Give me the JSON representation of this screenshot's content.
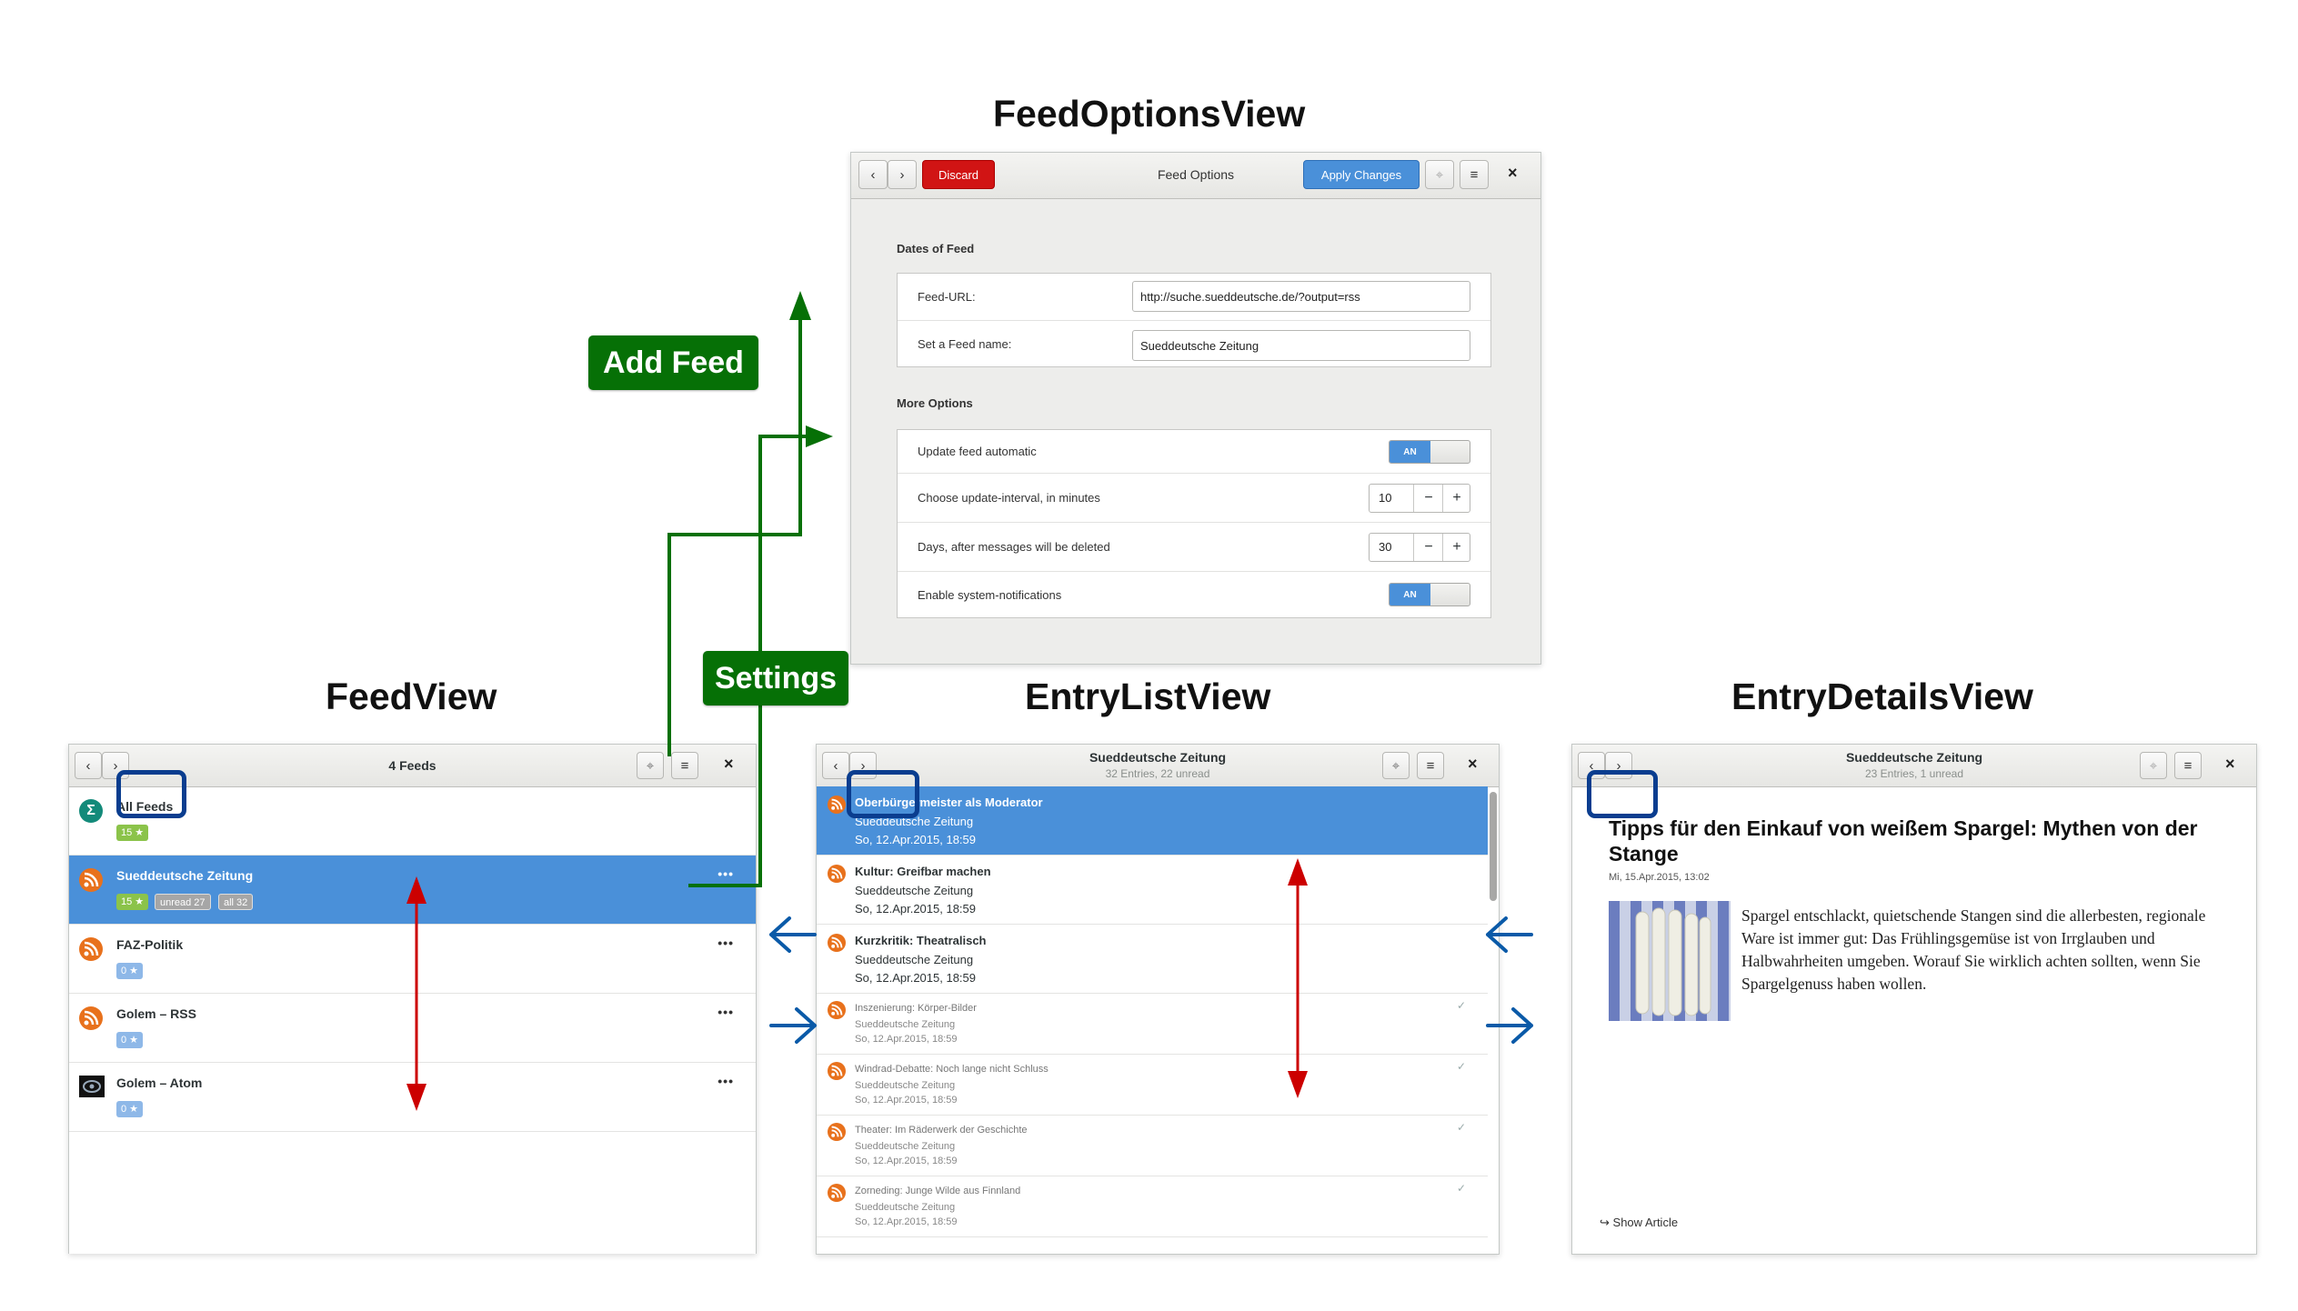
{
  "headings": {
    "feed_options": "FeedOptionsView",
    "feed_view": "FeedView",
    "entry_list": "EntryListView",
    "entry_details": "EntryDetailsView"
  },
  "labels": {
    "add_feed": "Add Feed",
    "settings": "Settings"
  },
  "colors": {
    "accent_blue": "#4a90d9",
    "discard_red": "#cc0000",
    "label_green": "#067006",
    "arrow_red": "#cc0000",
    "arrow_blue": "#0a5aa8",
    "rss_orange": "#e8711c"
  },
  "feed_options": {
    "discard": "Discard",
    "title": "Feed Options",
    "apply": "Apply Changes",
    "section_dates": "Dates of Feed",
    "feed_url_label": "Feed-URL:",
    "feed_url_value": "http://suche.sueddeutsche.de/?output=rss",
    "feed_name_label": "Set a Feed name:",
    "feed_name_value": "Sueddeutsche Zeitung",
    "section_more": "More Options",
    "update_auto_label": "Update feed automatic",
    "toggle_on": "AN",
    "interval_label": "Choose update-interval, in minutes",
    "interval_value": "10",
    "days_label": "Days, after messages will be deleted",
    "days_value": "30",
    "notifications_label": "Enable system-notifications",
    "minus": "−",
    "plus": "+"
  },
  "feed_view": {
    "title": "4 Feeds",
    "feeds": [
      {
        "name": "All Feeds",
        "badges": [
          "15 ★"
        ]
      },
      {
        "name": "Sueddeutsche Zeitung",
        "badges": [
          "15 ★",
          "unread 27",
          "all 32"
        ],
        "selected": true
      },
      {
        "name": "FAZ-Politik",
        "badges": [
          "0 ★"
        ]
      },
      {
        "name": "Golem – RSS",
        "badges": [
          "0 ★"
        ]
      },
      {
        "name": "Golem – Atom",
        "badges": [
          "0 ★"
        ]
      }
    ],
    "more": "•••"
  },
  "entry_list": {
    "title": "Sueddeutsche Zeitung",
    "subtitle": "32 Entries, 22 unread",
    "entries": [
      {
        "title": "Oberbürgermeister als Moderator",
        "source": "Sueddeutsche Zeitung",
        "date": "So, 12.Apr.2015, 18:59",
        "selected": true
      },
      {
        "title": "Kultur: Greifbar machen",
        "source": "Sueddeutsche Zeitung",
        "date": "So, 12.Apr.2015, 18:59"
      },
      {
        "title": "Kurzkritik: Theatralisch",
        "source": "Sueddeutsche Zeitung",
        "date": "So, 12.Apr.2015, 18:59"
      },
      {
        "title": "Inszenierung: Körper-Bilder",
        "source": "Sueddeutsche Zeitung",
        "date": "So, 12.Apr.2015, 18:59",
        "read": true
      },
      {
        "title": "Windrad-Debatte: Noch lange nicht Schluss",
        "source": "Sueddeutsche Zeitung",
        "date": "So, 12.Apr.2015, 18:59",
        "read": true
      },
      {
        "title": "Theater: Im Räderwerk der Geschichte",
        "source": "Sueddeutsche Zeitung",
        "date": "So, 12.Apr.2015, 18:59",
        "read": true
      },
      {
        "title": "Zorneding: Junge Wilde aus Finnland",
        "source": "Sueddeutsche Zeitung",
        "date": "So, 12.Apr.2015, 18:59",
        "read": true
      }
    ],
    "check": "✓"
  },
  "entry_details": {
    "title": "Sueddeutsche Zeitung",
    "subtitle": "23 Entries, 1 unread",
    "article_title": "Tipps für den Einkauf von weißem Spargel: Mythen von der Stange",
    "article_date": "Mi, 15.Apr.2015, 13:02",
    "article_text": "Spargel entschlackt, quietschende Stangen sind die allerbesten, regionale Ware ist immer gut: Das Frühlingsgemüse ist von Irrglauben und Halbwahrheiten umgeben. Worauf Sie wirklich achten sollten, wenn Sie Spargelgenuss haben wollen.",
    "show_article": "Show Article",
    "show_article_icon": "↪"
  },
  "window": {
    "close": "×",
    "back": "‹",
    "forward": "›"
  }
}
